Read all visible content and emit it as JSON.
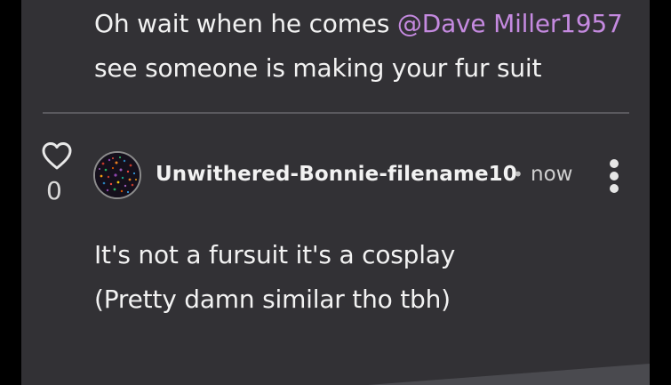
{
  "previous_comment": {
    "line1_prefix": "Oh wait when he comes ",
    "line1_mention": "@Dave Miller1957",
    "line2": "see someone is making your fur suit"
  },
  "comment": {
    "like_icon": "heart-outline-icon",
    "like_count": "0",
    "author": "Unwithered-Bonnie-filename10",
    "separator": "•",
    "time": "now",
    "more_icon": "vertical-ellipsis-icon",
    "body_line1": "It's not a fursuit it's a cosplay",
    "body_line2": "(Pretty damn similar tho tbh)"
  },
  "colors": {
    "page_background": "#000000",
    "panel_background": "#323135",
    "text": "#f2f2f2",
    "mention": "#c58ae0",
    "divider": "#5a595e"
  }
}
